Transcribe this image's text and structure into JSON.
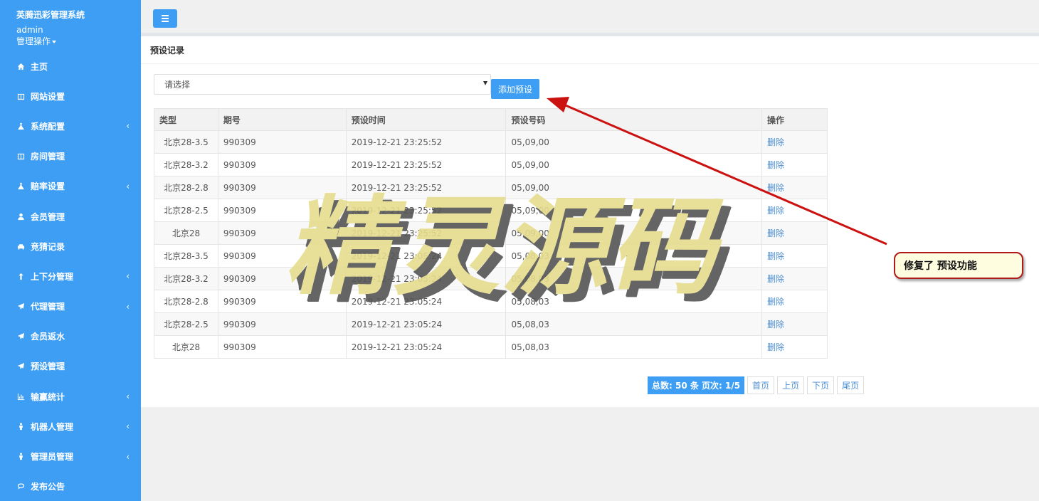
{
  "sidebar": {
    "brand_title": "英腾迅彩管理系统",
    "user": "admin",
    "ops_label": "管理操作",
    "items": [
      {
        "label": "主页",
        "icon": "home-icon",
        "expandable": false
      },
      {
        "label": "网站设置",
        "icon": "columns-icon",
        "expandable": false
      },
      {
        "label": "系统配置",
        "icon": "flask-icon",
        "expandable": true
      },
      {
        "label": "房间管理",
        "icon": "columns-icon",
        "expandable": false
      },
      {
        "label": "赔率设置",
        "icon": "flask-icon",
        "expandable": true
      },
      {
        "label": "会员管理",
        "icon": "user-icon",
        "expandable": false
      },
      {
        "label": "竞猜记录",
        "icon": "car-icon",
        "expandable": false
      },
      {
        "label": "上下分管理",
        "icon": "level-up-icon",
        "expandable": true
      },
      {
        "label": "代理管理",
        "icon": "paper-plane-icon",
        "expandable": true
      },
      {
        "label": "会员返水",
        "icon": "paper-plane-icon",
        "expandable": false
      },
      {
        "label": "预设管理",
        "icon": "paper-plane-icon",
        "expandable": false
      },
      {
        "label": "输赢统计",
        "icon": "bar-chart-icon",
        "expandable": true
      },
      {
        "label": "机器人管理",
        "icon": "male-icon",
        "expandable": true
      },
      {
        "label": "管理员管理",
        "icon": "male-icon",
        "expandable": true
      },
      {
        "label": "发布公告",
        "icon": "comment-icon",
        "expandable": false
      }
    ],
    "chevron": "‹"
  },
  "panel": {
    "title": "预设记录",
    "select_value": "请选择",
    "add_button": "添加预设"
  },
  "table": {
    "headers": [
      "类型",
      "期号",
      "预设时间",
      "预设号码",
      "操作"
    ],
    "rows": [
      [
        "北京28-3.5",
        "990309",
        "2019-12-21 23:25:52",
        "05,09,00",
        "删除"
      ],
      [
        "北京28-3.2",
        "990309",
        "2019-12-21 23:25:52",
        "05,09,00",
        "删除"
      ],
      [
        "北京28-2.8",
        "990309",
        "2019-12-21 23:25:52",
        "05,09,00",
        "删除"
      ],
      [
        "北京28-2.5",
        "990309",
        "2019-12-21 23:25:52",
        "05,09,00",
        "删除"
      ],
      [
        "北京28",
        "990309",
        "2019-12-21 23:25:52",
        "05,09,00",
        "删除"
      ],
      [
        "北京28-3.5",
        "990309",
        "2019-12-21 23:05:24",
        "05,08,03",
        "删除"
      ],
      [
        "北京28-3.2",
        "990309",
        "2019-12-21 23:05:24",
        "05,08,03",
        "删除"
      ],
      [
        "北京28-2.8",
        "990309",
        "2019-12-21 23:05:24",
        "05,08,03",
        "删除"
      ],
      [
        "北京28-2.5",
        "990309",
        "2019-12-21 23:05:24",
        "05,08,03",
        "删除"
      ],
      [
        "北京28",
        "990309",
        "2019-12-21 23:05:24",
        "05,08,03",
        "删除"
      ]
    ]
  },
  "pager": {
    "total": "总数: 50 条 页次: 1/5",
    "first": "首页",
    "prev": "上页",
    "next": "下页",
    "last": "尾页"
  },
  "watermark": "精灵源码",
  "annotation": "修复了 预设功能",
  "colors": {
    "primary": "#3d9ef4",
    "link": "#4b8ed0",
    "annotation_border": "#b01a1a",
    "arrow": "#cc1111"
  }
}
